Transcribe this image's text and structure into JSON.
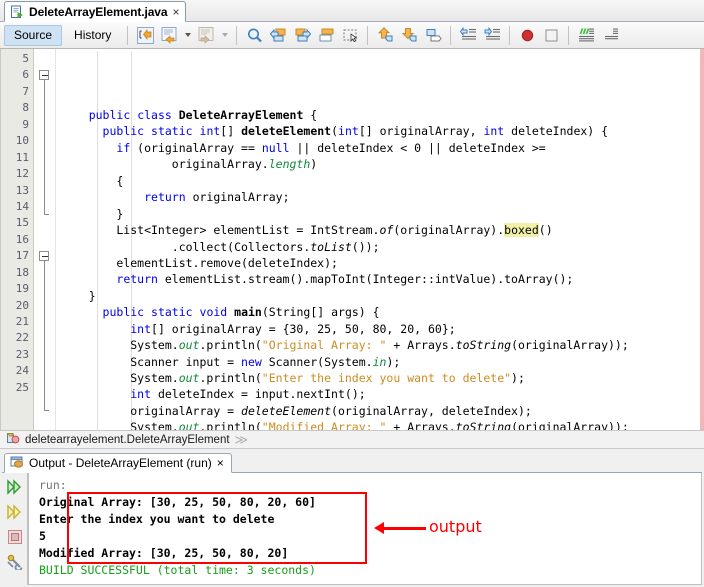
{
  "editor_tab": {
    "label": "DeleteArrayElement.java",
    "close": "×",
    "icon": "java-file-icon"
  },
  "toolbar": {
    "source_label": "Source",
    "history_label": "History",
    "buttons": [
      {
        "name": "last-edit-icon"
      },
      {
        "name": "back-history-icon"
      },
      {
        "name": "forward-history-icon"
      },
      {
        "name": "find-selection-icon"
      },
      {
        "name": "previous-bookmark-icon"
      },
      {
        "name": "next-bookmark-icon"
      },
      {
        "name": "toggle-rectangular-selection-icon"
      },
      {
        "name": "select-rectangle-icon"
      },
      {
        "name": "previous-error-icon"
      },
      {
        "name": "next-error-icon"
      },
      {
        "name": "toggle-highlight-icon"
      },
      {
        "name": "shift-left-icon"
      },
      {
        "name": "shift-right-icon"
      },
      {
        "name": "toggle-breakpoint-icon"
      },
      {
        "name": "stop-icon"
      },
      {
        "name": "inspect-icon"
      },
      {
        "name": "comment-icon"
      }
    ]
  },
  "code": {
    "first_line": 5,
    "lines": [
      {
        "n": 5,
        "tokens": [
          {
            "t": "    ",
            "c": "pln"
          },
          {
            "t": "public",
            "c": "kw"
          },
          {
            "t": " ",
            "c": "pln"
          },
          {
            "t": "class",
            "c": "kw"
          },
          {
            "t": " ",
            "c": "pln"
          },
          {
            "t": "DeleteArrayElement",
            "c": "decl"
          },
          {
            "t": " {",
            "c": "pln"
          }
        ]
      },
      {
        "n": 6,
        "tokens": [
          {
            "t": "      ",
            "c": "pln"
          },
          {
            "t": "public",
            "c": "kw"
          },
          {
            "t": " ",
            "c": "pln"
          },
          {
            "t": "static",
            "c": "kw"
          },
          {
            "t": " ",
            "c": "pln"
          },
          {
            "t": "int",
            "c": "kw"
          },
          {
            "t": "[] ",
            "c": "pln"
          },
          {
            "t": "deleteElement",
            "c": "mthb"
          },
          {
            "t": "(",
            "c": "pln"
          },
          {
            "t": "int",
            "c": "kw"
          },
          {
            "t": "[] originalArray, ",
            "c": "pln"
          },
          {
            "t": "int",
            "c": "kw"
          },
          {
            "t": " deleteIndex) {",
            "c": "pln"
          }
        ]
      },
      {
        "n": 7,
        "tokens": [
          {
            "t": "        ",
            "c": "pln"
          },
          {
            "t": "if",
            "c": "kw"
          },
          {
            "t": " (originalArray == ",
            "c": "pln"
          },
          {
            "t": "null",
            "c": "kw"
          },
          {
            "t": " || deleteIndex < 0 || deleteIndex >=",
            "c": "pln"
          }
        ]
      },
      {
        "n": 8,
        "tokens": [
          {
            "t": "                originalArray.",
            "c": "pln"
          },
          {
            "t": "length",
            "c": "fld"
          },
          {
            "t": ")",
            "c": "pln"
          }
        ]
      },
      {
        "n": 9,
        "tokens": [
          {
            "t": "        {",
            "c": "pln"
          }
        ]
      },
      {
        "n": 10,
        "tokens": [
          {
            "t": "            ",
            "c": "pln"
          },
          {
            "t": "return",
            "c": "kw"
          },
          {
            "t": " originalArray;",
            "c": "pln"
          }
        ]
      },
      {
        "n": 11,
        "tokens": [
          {
            "t": "        }",
            "c": "pln"
          }
        ]
      },
      {
        "n": 12,
        "tokens": [
          {
            "t": "        List<Integer> elementList = IntStream.",
            "c": "pln"
          },
          {
            "t": "of",
            "c": "mth"
          },
          {
            "t": "(originalArray).",
            "c": "pln"
          },
          {
            "t": "boxed",
            "c": "hl"
          },
          {
            "t": "()",
            "c": "pln"
          }
        ]
      },
      {
        "n": 13,
        "tokens": [
          {
            "t": "                .collect(Collectors.",
            "c": "pln"
          },
          {
            "t": "toList",
            "c": "mth"
          },
          {
            "t": "());",
            "c": "pln"
          }
        ]
      },
      {
        "n": 14,
        "tokens": [
          {
            "t": "        elementList.remove(deleteIndex);",
            "c": "pln"
          }
        ]
      },
      {
        "n": 15,
        "tokens": [
          {
            "t": "        ",
            "c": "pln"
          },
          {
            "t": "return",
            "c": "kw"
          },
          {
            "t": " elementList.stream().mapToInt(Integer::intValue).toArray();",
            "c": "pln"
          }
        ]
      },
      {
        "n": 16,
        "tokens": [
          {
            "t": "    }",
            "c": "pln"
          }
        ]
      },
      {
        "n": 17,
        "tokens": [
          {
            "t": "      ",
            "c": "pln"
          },
          {
            "t": "public",
            "c": "kw"
          },
          {
            "t": " ",
            "c": "pln"
          },
          {
            "t": "static",
            "c": "kw"
          },
          {
            "t": " ",
            "c": "pln"
          },
          {
            "t": "void",
            "c": "kw"
          },
          {
            "t": " ",
            "c": "pln"
          },
          {
            "t": "main",
            "c": "mthb"
          },
          {
            "t": "(String[] args) {",
            "c": "pln"
          }
        ]
      },
      {
        "n": 18,
        "tokens": [
          {
            "t": "          ",
            "c": "pln"
          },
          {
            "t": "int",
            "c": "kw"
          },
          {
            "t": "[] originalArray = {30, 25, 50, 80, 20, 60};",
            "c": "pln"
          }
        ]
      },
      {
        "n": 19,
        "tokens": [
          {
            "t": "          System.",
            "c": "pln"
          },
          {
            "t": "out",
            "c": "fld"
          },
          {
            "t": ".println(",
            "c": "pln"
          },
          {
            "t": "\"Original Array: \"",
            "c": "str"
          },
          {
            "t": " + Arrays.",
            "c": "pln"
          },
          {
            "t": "toString",
            "c": "mth"
          },
          {
            "t": "(originalArray));",
            "c": "pln"
          }
        ]
      },
      {
        "n": 20,
        "tokens": [
          {
            "t": "          Scanner input = ",
            "c": "pln"
          },
          {
            "t": "new",
            "c": "kw"
          },
          {
            "t": " Scanner(System.",
            "c": "pln"
          },
          {
            "t": "in",
            "c": "fld"
          },
          {
            "t": ");",
            "c": "pln"
          }
        ]
      },
      {
        "n": 21,
        "tokens": [
          {
            "t": "          System.",
            "c": "pln"
          },
          {
            "t": "out",
            "c": "fld"
          },
          {
            "t": ".println(",
            "c": "pln"
          },
          {
            "t": "\"Enter the index you want to delete\"",
            "c": "str"
          },
          {
            "t": ");",
            "c": "pln"
          }
        ]
      },
      {
        "n": 22,
        "tokens": [
          {
            "t": "          ",
            "c": "pln"
          },
          {
            "t": "int",
            "c": "kw"
          },
          {
            "t": " deleteIndex = input.nextInt();",
            "c": "pln"
          }
        ]
      },
      {
        "n": 23,
        "tokens": [
          {
            "t": "          originalArray = ",
            "c": "pln"
          },
          {
            "t": "deleteElement",
            "c": "mth"
          },
          {
            "t": "(originalArray, deleteIndex);",
            "c": "pln"
          }
        ]
      },
      {
        "n": 24,
        "tokens": [
          {
            "t": "          System.",
            "c": "pln"
          },
          {
            "t": "out",
            "c": "fld"
          },
          {
            "t": ".println(",
            "c": "pln"
          },
          {
            "t": "\"Modified Array: \"",
            "c": "str"
          },
          {
            "t": " + Arrays.",
            "c": "pln"
          },
          {
            "t": "toString",
            "c": "mth"
          },
          {
            "t": "(originalArray));",
            "c": "pln"
          }
        ]
      },
      {
        "n": 25,
        "tokens": [
          {
            "t": "      }  ",
            "c": "pln"
          }
        ],
        "current": true
      }
    ]
  },
  "breadcrumb": {
    "icon": "class-icon",
    "text": "deletearrayelement.DeleteArrayElement",
    "chevron": "≫"
  },
  "output": {
    "tab_label": "Output - DeleteArrayElement (run)",
    "tab_close": "×",
    "tab_icon": "output-window-icon",
    "side_buttons": [
      {
        "name": "rerun-icon"
      },
      {
        "name": "rerun-alternate-icon"
      },
      {
        "name": "stop-process-icon"
      },
      {
        "name": "settings-icon"
      }
    ],
    "lines": [
      {
        "text": "run:",
        "style": "grey"
      },
      {
        "text": "Original Array: [30, 25, 50, 80, 20, 60]",
        "style": "blk"
      },
      {
        "text": "Enter the index you want to delete",
        "style": "blk"
      },
      {
        "text": "5",
        "style": "blk"
      },
      {
        "text": "Modified Array: [30, 25, 50, 80, 20]",
        "style": "blk"
      },
      {
        "text": "BUILD SUCCESSFUL (total time: 3 seconds)",
        "style": "grn"
      }
    ]
  },
  "annotation": {
    "label": "output",
    "color": "#ff0000"
  }
}
